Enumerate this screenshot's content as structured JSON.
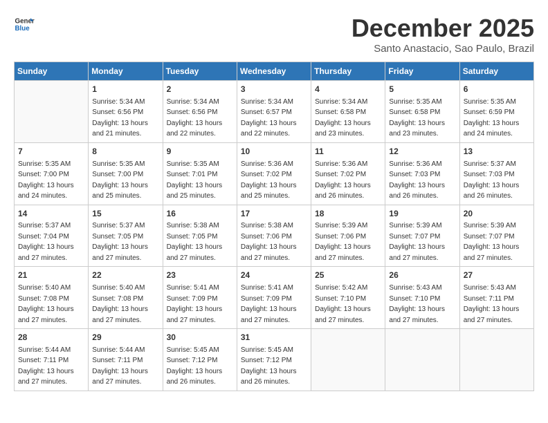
{
  "header": {
    "logo_line1": "General",
    "logo_line2": "Blue",
    "title": "December 2025",
    "subtitle": "Santo Anastacio, Sao Paulo, Brazil"
  },
  "weekdays": [
    "Sunday",
    "Monday",
    "Tuesday",
    "Wednesday",
    "Thursday",
    "Friday",
    "Saturday"
  ],
  "weeks": [
    [
      {
        "day": "",
        "info": ""
      },
      {
        "day": "1",
        "info": "Sunrise: 5:34 AM\nSunset: 6:56 PM\nDaylight: 13 hours\nand 21 minutes."
      },
      {
        "day": "2",
        "info": "Sunrise: 5:34 AM\nSunset: 6:56 PM\nDaylight: 13 hours\nand 22 minutes."
      },
      {
        "day": "3",
        "info": "Sunrise: 5:34 AM\nSunset: 6:57 PM\nDaylight: 13 hours\nand 22 minutes."
      },
      {
        "day": "4",
        "info": "Sunrise: 5:34 AM\nSunset: 6:58 PM\nDaylight: 13 hours\nand 23 minutes."
      },
      {
        "day": "5",
        "info": "Sunrise: 5:35 AM\nSunset: 6:58 PM\nDaylight: 13 hours\nand 23 minutes."
      },
      {
        "day": "6",
        "info": "Sunrise: 5:35 AM\nSunset: 6:59 PM\nDaylight: 13 hours\nand 24 minutes."
      }
    ],
    [
      {
        "day": "7",
        "info": "Sunrise: 5:35 AM\nSunset: 7:00 PM\nDaylight: 13 hours\nand 24 minutes."
      },
      {
        "day": "8",
        "info": "Sunrise: 5:35 AM\nSunset: 7:00 PM\nDaylight: 13 hours\nand 25 minutes."
      },
      {
        "day": "9",
        "info": "Sunrise: 5:35 AM\nSunset: 7:01 PM\nDaylight: 13 hours\nand 25 minutes."
      },
      {
        "day": "10",
        "info": "Sunrise: 5:36 AM\nSunset: 7:02 PM\nDaylight: 13 hours\nand 25 minutes."
      },
      {
        "day": "11",
        "info": "Sunrise: 5:36 AM\nSunset: 7:02 PM\nDaylight: 13 hours\nand 26 minutes."
      },
      {
        "day": "12",
        "info": "Sunrise: 5:36 AM\nSunset: 7:03 PM\nDaylight: 13 hours\nand 26 minutes."
      },
      {
        "day": "13",
        "info": "Sunrise: 5:37 AM\nSunset: 7:03 PM\nDaylight: 13 hours\nand 26 minutes."
      }
    ],
    [
      {
        "day": "14",
        "info": "Sunrise: 5:37 AM\nSunset: 7:04 PM\nDaylight: 13 hours\nand 27 minutes."
      },
      {
        "day": "15",
        "info": "Sunrise: 5:37 AM\nSunset: 7:05 PM\nDaylight: 13 hours\nand 27 minutes."
      },
      {
        "day": "16",
        "info": "Sunrise: 5:38 AM\nSunset: 7:05 PM\nDaylight: 13 hours\nand 27 minutes."
      },
      {
        "day": "17",
        "info": "Sunrise: 5:38 AM\nSunset: 7:06 PM\nDaylight: 13 hours\nand 27 minutes."
      },
      {
        "day": "18",
        "info": "Sunrise: 5:39 AM\nSunset: 7:06 PM\nDaylight: 13 hours\nand 27 minutes."
      },
      {
        "day": "19",
        "info": "Sunrise: 5:39 AM\nSunset: 7:07 PM\nDaylight: 13 hours\nand 27 minutes."
      },
      {
        "day": "20",
        "info": "Sunrise: 5:39 AM\nSunset: 7:07 PM\nDaylight: 13 hours\nand 27 minutes."
      }
    ],
    [
      {
        "day": "21",
        "info": "Sunrise: 5:40 AM\nSunset: 7:08 PM\nDaylight: 13 hours\nand 27 minutes."
      },
      {
        "day": "22",
        "info": "Sunrise: 5:40 AM\nSunset: 7:08 PM\nDaylight: 13 hours\nand 27 minutes."
      },
      {
        "day": "23",
        "info": "Sunrise: 5:41 AM\nSunset: 7:09 PM\nDaylight: 13 hours\nand 27 minutes."
      },
      {
        "day": "24",
        "info": "Sunrise: 5:41 AM\nSunset: 7:09 PM\nDaylight: 13 hours\nand 27 minutes."
      },
      {
        "day": "25",
        "info": "Sunrise: 5:42 AM\nSunset: 7:10 PM\nDaylight: 13 hours\nand 27 minutes."
      },
      {
        "day": "26",
        "info": "Sunrise: 5:43 AM\nSunset: 7:10 PM\nDaylight: 13 hours\nand 27 minutes."
      },
      {
        "day": "27",
        "info": "Sunrise: 5:43 AM\nSunset: 7:11 PM\nDaylight: 13 hours\nand 27 minutes."
      }
    ],
    [
      {
        "day": "28",
        "info": "Sunrise: 5:44 AM\nSunset: 7:11 PM\nDaylight: 13 hours\nand 27 minutes."
      },
      {
        "day": "29",
        "info": "Sunrise: 5:44 AM\nSunset: 7:11 PM\nDaylight: 13 hours\nand 27 minutes."
      },
      {
        "day": "30",
        "info": "Sunrise: 5:45 AM\nSunset: 7:12 PM\nDaylight: 13 hours\nand 26 minutes."
      },
      {
        "day": "31",
        "info": "Sunrise: 5:45 AM\nSunset: 7:12 PM\nDaylight: 13 hours\nand 26 minutes."
      },
      {
        "day": "",
        "info": ""
      },
      {
        "day": "",
        "info": ""
      },
      {
        "day": "",
        "info": ""
      }
    ]
  ]
}
